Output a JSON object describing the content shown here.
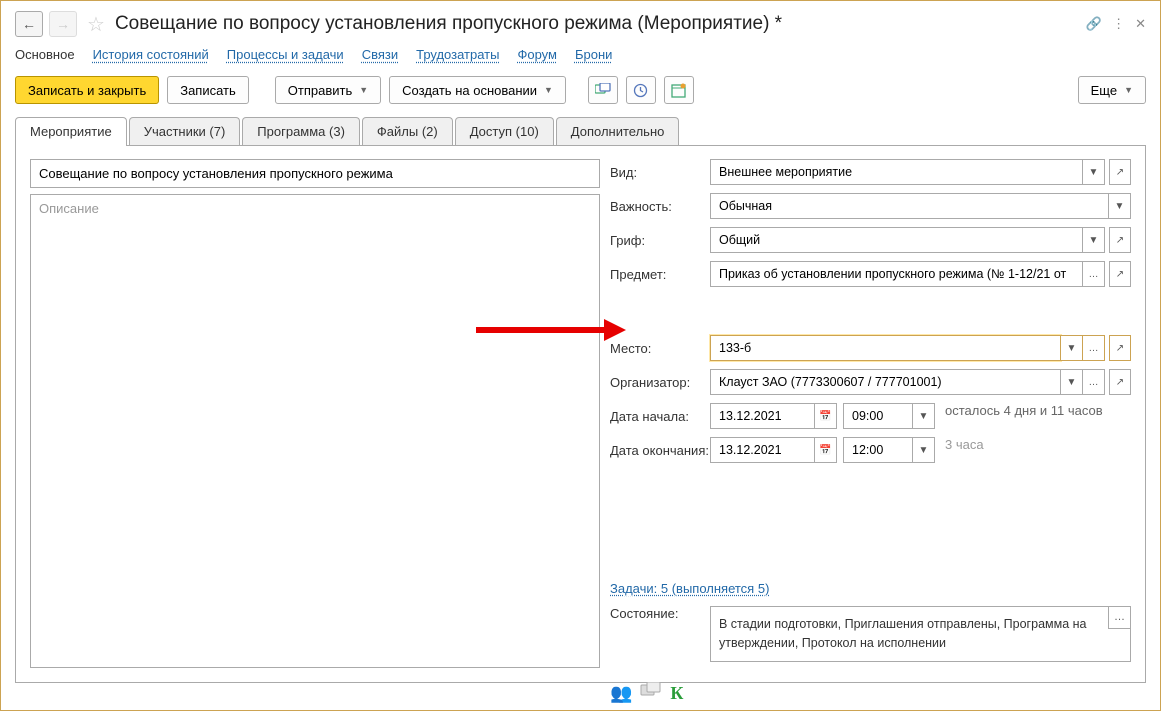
{
  "title": "Совещание по вопросу установления пропускного режима (Мероприятие) *",
  "nav": {
    "main": "Основное",
    "history": "История состояний",
    "processes": "Процессы и задачи",
    "links": "Связи",
    "labor": "Трудозатраты",
    "forum": "Форум",
    "bookings": "Брони"
  },
  "toolbar": {
    "save_close": "Записать и закрыть",
    "save": "Записать",
    "send": "Отправить",
    "create_based": "Создать на основании",
    "more": "Еще"
  },
  "tabs": {
    "event": "Мероприятие",
    "participants": "Участники (7)",
    "program": "Программа (3)",
    "files": "Файлы (2)",
    "access": "Доступ (10)",
    "additional": "Дополнительно"
  },
  "form": {
    "name_value": "Совещание по вопросу установления пропускного режима",
    "desc_placeholder": "Описание",
    "fields": {
      "type_label": "Вид:",
      "type_value": "Внешнее мероприятие",
      "importance_label": "Важность:",
      "importance_value": "Обычная",
      "grif_label": "Гриф:",
      "grif_value": "Общий",
      "subject_label": "Предмет:",
      "subject_value": "Приказ об установлении пропускного режима (№ 1-12/21 от",
      "place_label": "Место:",
      "place_value": "133-б",
      "organizer_label": "Организатор:",
      "organizer_value": "Клауст ЗАО (7773300607 / 777701001)",
      "start_label": "Дата начала:",
      "start_date": "13.12.2021",
      "start_time": "09:00",
      "start_note": "осталось 4 дня и 11 часов",
      "end_label": "Дата окончания:",
      "end_date": "13.12.2021",
      "end_time": "12:00",
      "end_note": "3 часа"
    },
    "tasks_link": "Задачи: 5 (выполняется 5)",
    "state_label": "Состояние:",
    "state_value": "В стадии подготовки, Приглашения отправлены, Программа на утверждении, Протокол на исполнении"
  }
}
